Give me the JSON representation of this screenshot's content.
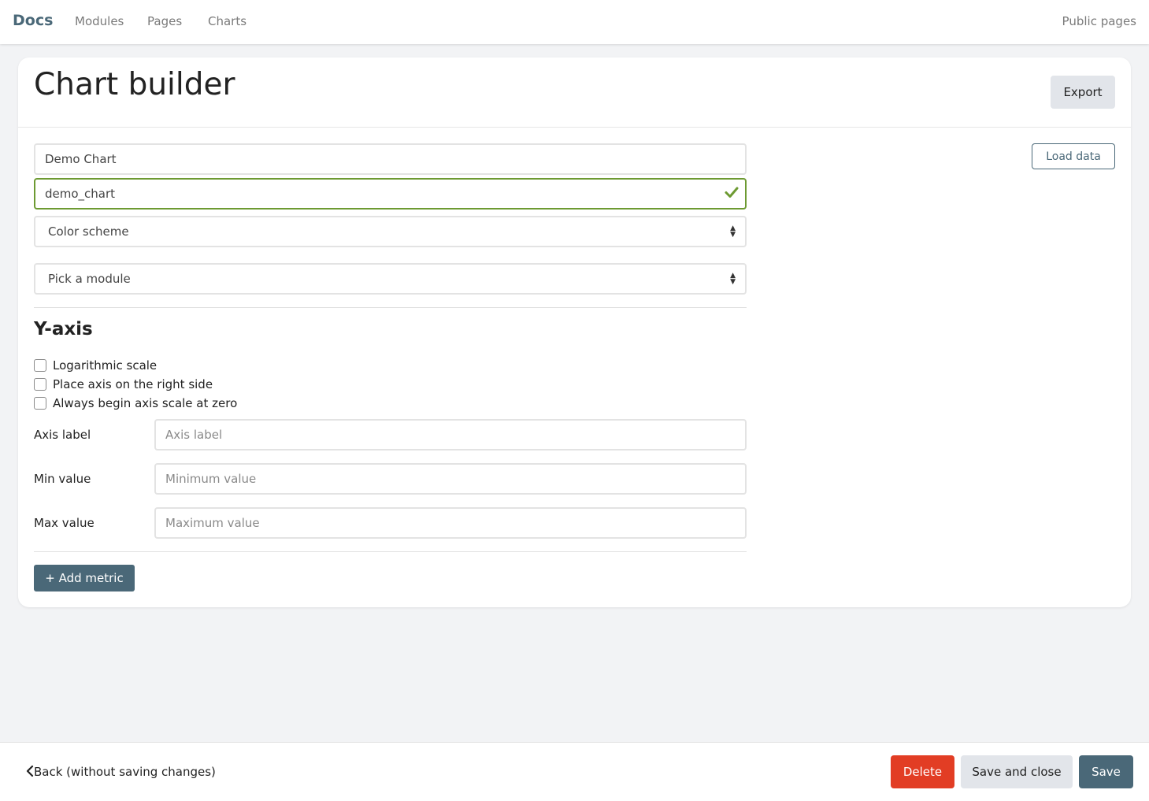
{
  "nav": {
    "brand": "Docs",
    "links": [
      "Modules",
      "Pages",
      "Charts"
    ],
    "right_link": "Public pages"
  },
  "card": {
    "title": "Chart builder",
    "export_label": "Export",
    "load_data_label": "Load data",
    "name_value": "Demo Chart",
    "slug_value": "demo_chart",
    "color_scheme_label": "Color scheme",
    "module_label": "Pick a module"
  },
  "yaxis": {
    "title": "Y-axis",
    "checkboxes": [
      "Logarithmic scale",
      "Place axis on the right side",
      "Always begin axis scale at zero"
    ],
    "axis_label": {
      "label": "Axis label",
      "placeholder": "Axis label"
    },
    "min_value": {
      "label": "Min value",
      "placeholder": "Minimum value"
    },
    "max_value": {
      "label": "Max value",
      "placeholder": "Maximum value"
    }
  },
  "add_metric_label": "+ Add metric",
  "footer": {
    "back_label": "Back (without saving changes)",
    "delete_label": "Delete",
    "save_close_label": "Save and close",
    "save_label": "Save"
  },
  "colors": {
    "accent": "#4a6878",
    "valid": "#6d9a32",
    "danger": "#e23d24"
  }
}
